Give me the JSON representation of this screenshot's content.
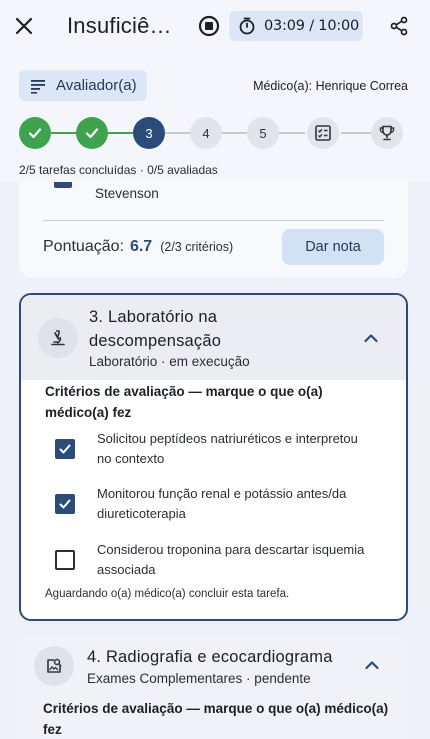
{
  "header": {
    "title": "Insuficiê…",
    "timer": "03:09 / 10:00",
    "colors": {
      "primary": "#2b4c79",
      "done": "#3fa34d",
      "chip": "#dbe6f6"
    }
  },
  "evaluator": {
    "role_label": "Avaliador(a)",
    "doctor_label": "Médico(a): Henrique Correa"
  },
  "stepper": {
    "steps": [
      {
        "label": "",
        "state": "done"
      },
      {
        "label": "",
        "state": "done"
      },
      {
        "label": "3",
        "state": "current"
      },
      {
        "label": "4",
        "state": "todo"
      },
      {
        "label": "5",
        "state": "todo"
      },
      {
        "icon": "checklist-icon",
        "state": "todo"
      },
      {
        "icon": "trophy-icon",
        "state": "todo"
      }
    ],
    "progress_text": "2/5 tarefas concluídas · 0/5 avaliadas"
  },
  "task2": {
    "criterion_tail": "Stevenson",
    "score_label": "Pontuação:",
    "score_value": "6.7",
    "score_criteria": "(2/3 critérios)",
    "grade_button": "Dar nota"
  },
  "task3": {
    "title": "3. Laboratório na descompensação",
    "subtitle": "Laboratório · em execução",
    "criteria_title": "Critérios de avaliação — marque o que o(a) médico(a) fez",
    "criteria": [
      {
        "text": "Solicitou peptídeos natriuréticos e interpretou no contexto",
        "checked": true
      },
      {
        "text": "Monitorou função renal e potássio antes/da diureticoterapia",
        "checked": true
      },
      {
        "text": "Considerou troponina para descartar isquemia associada",
        "checked": false
      }
    ],
    "waiting_text": "Aguardando o(a) médico(a) concluir esta tarefa."
  },
  "task4": {
    "title": "4. Radiografia e ecocardiograma",
    "subtitle": "Exames Complementares · pendente",
    "criteria_title": "Critérios de avaliação — marque o que o(a) médico(a) fez"
  }
}
